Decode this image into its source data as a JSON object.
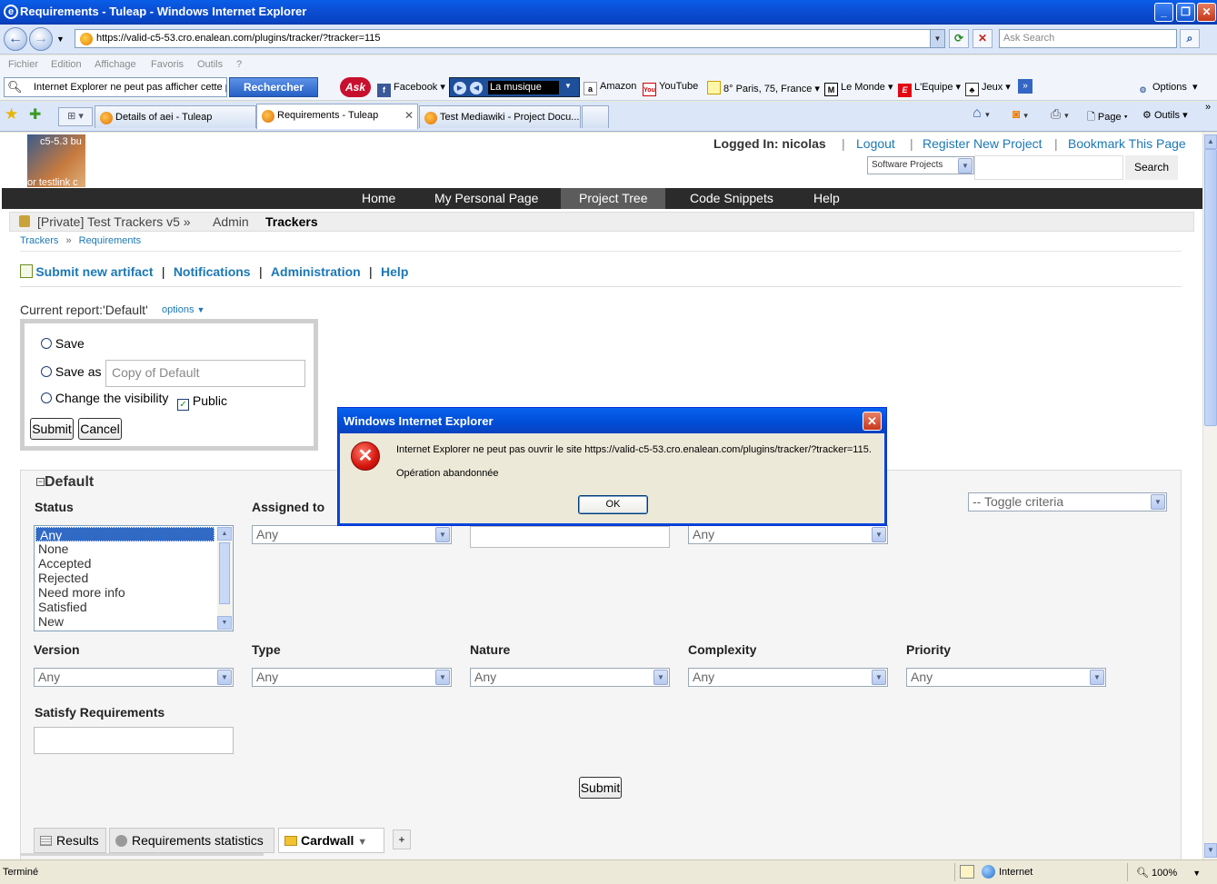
{
  "window": {
    "title": "Requirements - Tuleap - Windows Internet Explorer"
  },
  "address": {
    "url": "https://valid-c5-53.cro.enalean.com/plugins/tracker/?tracker=115",
    "search_placeholder": "Ask Search"
  },
  "menu": [
    "Fichier",
    "Edition",
    "Affichage",
    "Favoris",
    "Outils",
    "?"
  ],
  "toolbar": {
    "search_value": "Internet Explorer ne peut pas afficher cette p",
    "search_button": "Rechercher",
    "items": [
      "Facebook",
      "La musique",
      "Amazon",
      "YouTube",
      "8° Paris, 75, France",
      "Le Monde",
      "L'Equipe",
      "Jeux",
      "Options"
    ]
  },
  "tabs": [
    {
      "label": "Details of aei - Tuleap"
    },
    {
      "label": "Requirements - Tuleap"
    },
    {
      "label": "Test Mediawiki - Project Docu..."
    }
  ],
  "commandbar": {
    "page": "Page",
    "tools": "Outils"
  },
  "site": {
    "logo_top": "c5-5.3 bu",
    "logo_bottom": "or testlink c",
    "logged_in": "Logged In: nicolas",
    "logout": "Logout",
    "register": "Register New Project",
    "bookmark": "Bookmark This Page",
    "search_scope": "Software Projects",
    "search_button": "Search",
    "nav": [
      "Home",
      "My Personal Page",
      "Project Tree",
      "Code Snippets",
      "Help"
    ]
  },
  "project": {
    "name": "[Private] Test Trackers v5 »",
    "admin": "Admin",
    "trackers": "Trackers"
  },
  "breadcrumb": {
    "trackers": "Trackers",
    "sep": "»",
    "current": "Requirements"
  },
  "actions": {
    "submit": "Submit new artifact",
    "notifications": "Notifications",
    "administration": "Administration",
    "help": "Help"
  },
  "report": {
    "current": "Current report:'Default'",
    "options": "options",
    "save": "Save",
    "save_as": "Save as",
    "save_as_value": "Copy of Default",
    "change_visibility": "Change the visibility",
    "public": "Public",
    "submit": "Submit",
    "cancel": "Cancel"
  },
  "criteria": {
    "title": "Default",
    "toggle": "-- Toggle criteria",
    "status_label": "Status",
    "status_options": [
      "Any",
      "None",
      "Accepted",
      "Rejected",
      "Need more info",
      "Satisfied",
      "New"
    ],
    "assigned_label": "Assigned to",
    "any": "Any",
    "version": "Version",
    "type": "Type",
    "nature": "Nature",
    "complexity": "Complexity",
    "priority": "Priority",
    "satisfy": "Satisfy Requirements",
    "submit": "Submit"
  },
  "renderers": {
    "results": "Results",
    "stats": "Requirements statistics",
    "cardwall": "Cardwall",
    "add": "+"
  },
  "dialog": {
    "title": "Windows Internet Explorer",
    "message": "Internet Explorer ne peut pas ouvrir le site https://valid-c5-53.cro.enalean.com/plugins/tracker/?tracker=115.",
    "detail": "Opération abandonnée",
    "ok": "OK"
  },
  "status": {
    "text": "Terminé",
    "zone": "Internet",
    "zoom": "100%"
  }
}
